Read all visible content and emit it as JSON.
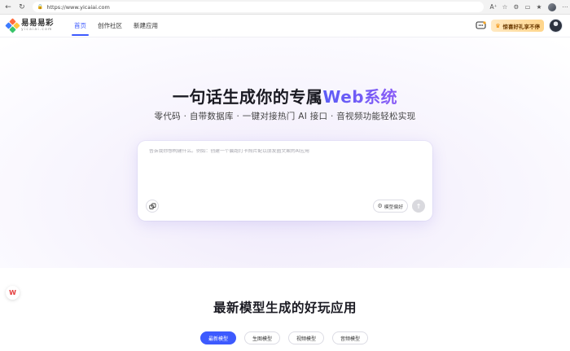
{
  "browser": {
    "url": "https://www.yicaiai.com",
    "back_icon": "arrow-left-icon",
    "refresh_icon": "refresh-icon"
  },
  "header": {
    "logo_cn": "易易易彩",
    "logo_en": "yicaiai.com",
    "nav": [
      {
        "label": "首页",
        "active": true
      },
      {
        "label": "创作社区",
        "active": false
      },
      {
        "label": "新建应用",
        "active": false
      }
    ],
    "promo_label": "惊喜好礼享不停"
  },
  "hero": {
    "title_main": "一句话生成你的专属",
    "title_highlight": "Web系统",
    "subtitle": "零代码 · 自带数据库 · 一键对接热门 AI 接口 · 音视频功能轻松实现",
    "prompt_placeholder": "告诉我你想构建什么。例如：创建一个晨跑打卡照片配以朋友圈文案的AI应用",
    "model_pref_label": "模型偏好"
  },
  "section": {
    "title": "最新模型生成的好玩应用",
    "tabs": [
      {
        "label": "最新模型",
        "active": true
      },
      {
        "label": "生图模型",
        "active": false
      },
      {
        "label": "视频模型",
        "active": false
      },
      {
        "label": "音频模型",
        "active": false
      }
    ]
  },
  "colors": {
    "accent": "#3d5afe",
    "highlight_gradient_start": "#5b5cf6",
    "highlight_gradient_end": "#8a5cf6"
  }
}
